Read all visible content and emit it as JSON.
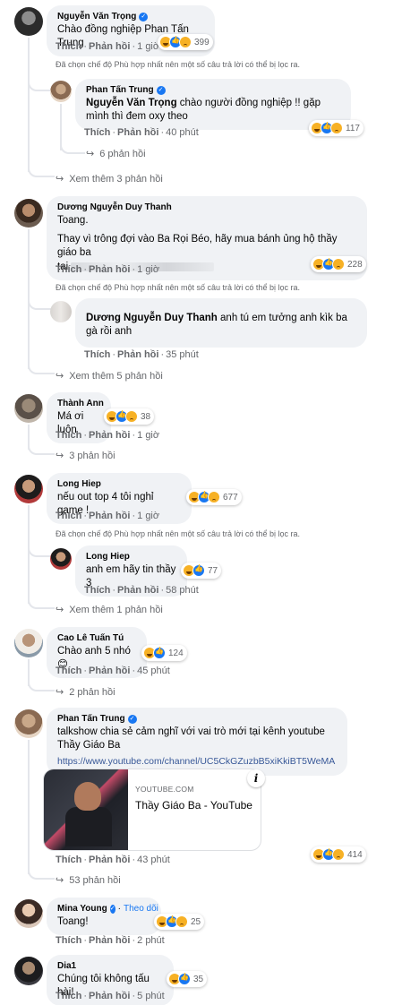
{
  "colors": {
    "bubble": "#f0f2f5",
    "meta_text": "#65676b",
    "link": "#385898",
    "verified": "#1877f2",
    "thread_line": "#e4e6eb"
  },
  "labels": {
    "like": "Thích",
    "reply": "Phản hồi",
    "dot": "·"
  },
  "notice": "Đã chọn chế độ Phù hợp nhất nên một số câu trả lời có thể bị lọc ra.",
  "comments": [
    {
      "name": "Nguyễn Văn Trọng",
      "verified": true,
      "text": "Chào đồng nghiệp Phan Tấn Trung",
      "time": "1 giờ",
      "reactions": {
        "icons": [
          "haha-icon",
          "like-icon",
          "sad-icon"
        ],
        "count": "399"
      },
      "reply": {
        "name": "Phan Tấn Trung",
        "verified": true,
        "mention": "Nguyễn Văn Trọng",
        "text": " chào người đồng nghiệp !! gặp mình thì đem oxy theo",
        "time": "40 phút",
        "reactions": {
          "count": "117"
        },
        "sub_replies": "6 phản hồi"
      },
      "more": "Xem thêm 3 phản hồi"
    },
    {
      "name": "Dương Nguyễn Duy Thanh",
      "verified": false,
      "text_line1": "Toang.",
      "text_line2": "Thay vì trông đợi vào Ba Rọi Béo, hãy mua bánh ủng hộ thầy giáo ba",
      "text_line3": "tại",
      "time": "1 giờ",
      "reactions": {
        "count": "228"
      },
      "reply": {
        "mention": "Dương Nguyễn Duy Thanh",
        "text": " anh tú em tưởng anh kìk ba gà rồi anh",
        "time": "35 phút"
      },
      "more": "Xem thêm 5 phản hồi"
    },
    {
      "name": "Thành Ann",
      "text": "Má ơi luôn",
      "time": "1 giờ",
      "reactions": {
        "count": "38"
      },
      "more": "3 phản hồi"
    },
    {
      "name": "Long Hiep",
      "text": "nếu out top 4 tôi nghỉ game !",
      "time": "1 giờ",
      "reactions": {
        "count": "677"
      },
      "reply": {
        "name": "Long Hiep",
        "text": "anh em hãy tin thầy 3",
        "time": "58 phút",
        "reactions": {
          "count": "77"
        }
      },
      "more": "Xem thêm 1 phản hồi"
    },
    {
      "name": "Cao Lê Tuấn Tú",
      "text": "Chào anh 5 nhó 😊",
      "time": "45 phút",
      "reactions": {
        "count": "124"
      },
      "more": "2 phản hồi"
    },
    {
      "name": "Phan Tấn Trung",
      "verified": true,
      "text": "talkshow chia sẻ cảm nghĩ với vai trò mới tại kênh youtube Thầy Giáo Ba",
      "link": "https://www.youtube.com/channel/UC5CkGZuzbB5xiKkiBT5WeMA",
      "preview": {
        "site": "YOUTUBE.COM",
        "title": "Thầy Giáo Ba - YouTube",
        "info": "i"
      },
      "time": "43 phút",
      "reactions": {
        "count": "414"
      },
      "more": "53 phản hồi"
    },
    {
      "name": "Mina Young",
      "verified": true,
      "follow": "Theo dõi",
      "text": "Toang!",
      "time": "2 phút",
      "reactions": {
        "count": "25"
      }
    },
    {
      "name": "Dia1",
      "text": "Chúng tôi không tấu hài!",
      "time": "5 phút",
      "reactions": {
        "count": "35"
      }
    }
  ]
}
